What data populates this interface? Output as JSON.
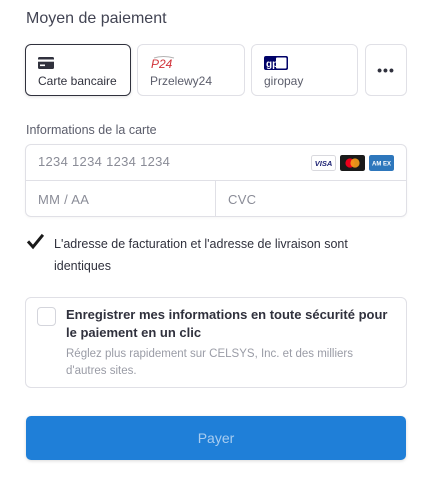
{
  "section_title": "Moyen de paiement",
  "payment_methods": [
    {
      "label": "Carte bancaire",
      "icon": "card-icon",
      "selected": true
    },
    {
      "label": "Przelewy24",
      "icon": "p24-logo-icon",
      "logo_text": "P24",
      "selected": false
    },
    {
      "label": "giropay",
      "icon": "giropay-logo-icon",
      "logo_text": "gp",
      "selected": false
    }
  ],
  "more_label": "•••",
  "card_info_label": "Informations de la carte",
  "card_number_placeholder": "1234 1234 1234 1234",
  "expiry_placeholder": "MM / AA",
  "cvc_placeholder": "CVC",
  "card_brands": [
    {
      "name": "visa",
      "text": "VISA"
    },
    {
      "name": "mastercard",
      "text": ""
    },
    {
      "name": "amex",
      "text": "AM EX"
    }
  ],
  "same_address": {
    "checked": true,
    "label": "L'adresse de facturation et l'adresse de livraison sont identiques"
  },
  "save_info": {
    "checked": false,
    "title": "Enregistrer mes informations en toute sécurité pour le paiement en un clic",
    "subtitle": "Réglez plus rapidement sur CELSYS, Inc. et des milliers d'autres sites."
  },
  "pay_button_label": "Payer",
  "colors": {
    "accent": "#1f7fd8",
    "text": "#30313d",
    "border": "#e0e0e6"
  }
}
